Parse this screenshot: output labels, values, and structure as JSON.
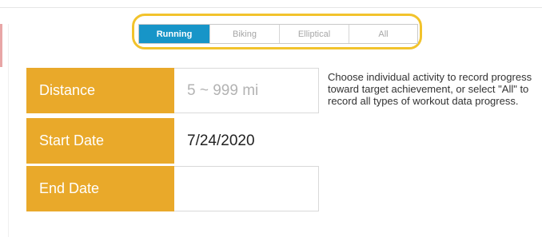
{
  "activity_tabs": [
    {
      "label": "Running",
      "active": true
    },
    {
      "label": "Biking",
      "active": false
    },
    {
      "label": "Elliptical",
      "active": false
    },
    {
      "label": "All",
      "active": false
    }
  ],
  "fields": {
    "distance": {
      "label": "Distance",
      "placeholder": "5 ~ 999 mi",
      "value": ""
    },
    "start_date": {
      "label": "Start Date",
      "value": "7/24/2020"
    },
    "end_date": {
      "label": "End Date",
      "value": ""
    }
  },
  "help_text": "Choose individual activity to record progress toward target achievement, or select \"All\" to record all types of workout data progress.",
  "colors": {
    "active_tab": "#1795c8",
    "label_background": "#e9a92a",
    "highlight_outline": "#f2c32c"
  }
}
